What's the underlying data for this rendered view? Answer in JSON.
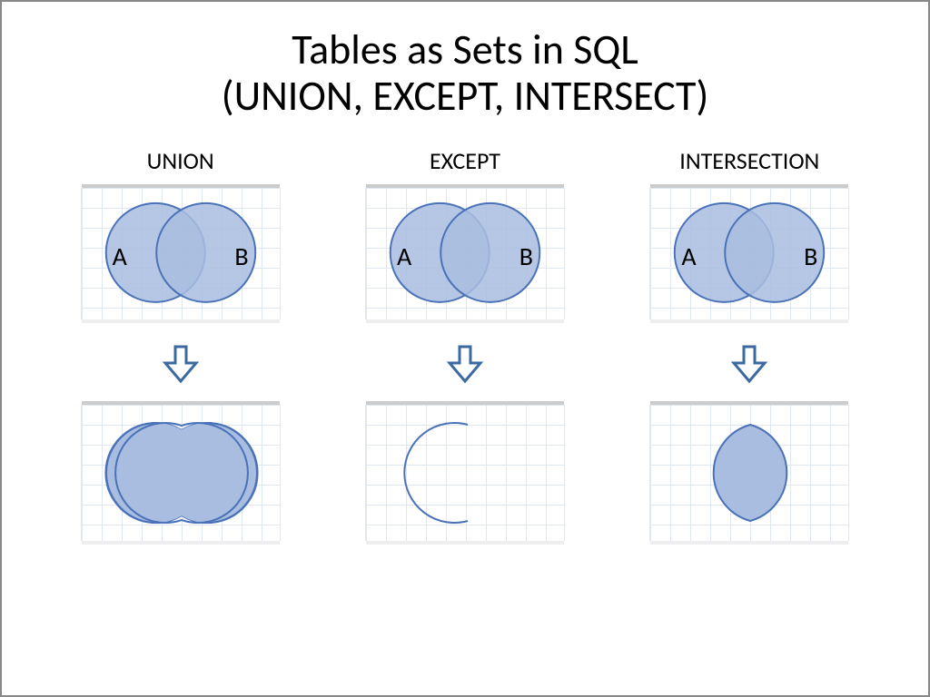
{
  "title_line1": "Tables as Sets in SQL",
  "title_line2": "(UNION, EXCEPT, INTERSECT)",
  "columns": [
    {
      "label": "UNION",
      "a": "A",
      "b": "B"
    },
    {
      "label": "EXCEPT",
      "a": "A",
      "b": "B"
    },
    {
      "label": "INTERSECTION",
      "a": "A",
      "b": "B"
    }
  ],
  "colors": {
    "fill": "#a9bde0",
    "fill_dark": "#8fa8d4",
    "stroke": "#4a72b8",
    "arrow_stroke": "#3b6aa0"
  }
}
